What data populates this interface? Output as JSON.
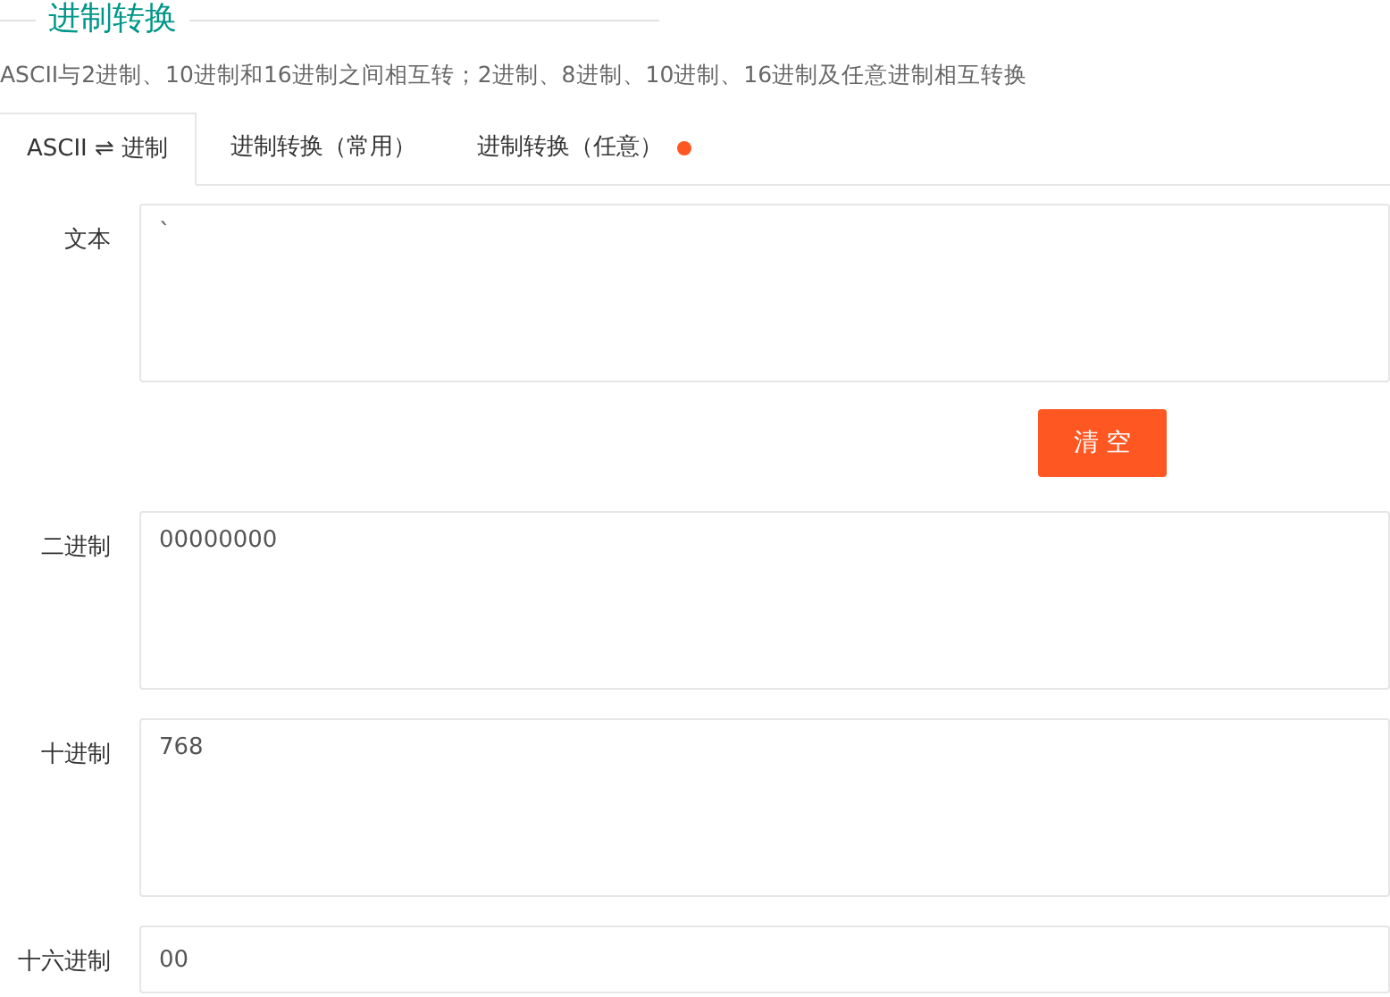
{
  "title": "进制转换",
  "description": "ASCII与2进制、10进制和16进制之间相互转；2进制、8进制、10进制、16进制及任意进制相互转换",
  "tabs": [
    {
      "label": "ASCII ⇌ 进制",
      "selected": true,
      "dot": false
    },
    {
      "label": "进制转换（常用）",
      "selected": false,
      "dot": false
    },
    {
      "label": "进制转换（任意）",
      "selected": false,
      "dot": true
    }
  ],
  "fields": [
    {
      "kind": "textarea",
      "label": "文本",
      "value": "`"
    },
    {
      "kind": "button",
      "label": "清 空"
    },
    {
      "kind": "textarea",
      "label": "二进制",
      "value": "00000000"
    },
    {
      "kind": "textarea",
      "label": "十进制",
      "value": "768"
    },
    {
      "kind": "input",
      "label": "十六进制",
      "value": "00"
    }
  ]
}
